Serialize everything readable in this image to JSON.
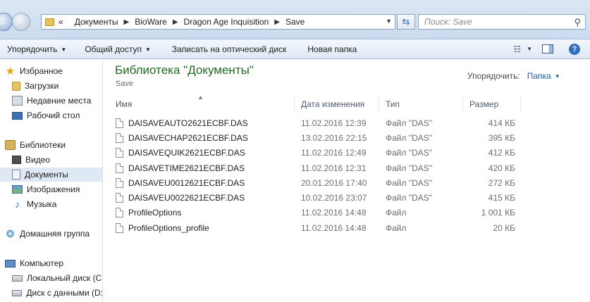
{
  "address": {
    "overflow": "«",
    "crumbs": [
      "Документы",
      "BioWare",
      "Dragon Age Inquisition",
      "Save"
    ]
  },
  "search": {
    "placeholder": "Поиск: Save"
  },
  "toolbar": {
    "organize": "Упорядочить",
    "share": "Общий доступ",
    "burn": "Записать на оптический диск",
    "new_folder": "Новая папка"
  },
  "nav": {
    "favorites": "Избранное",
    "downloads": "Загрузки",
    "recent": "Недавние места",
    "desktop": "Рабочий стол",
    "libraries": "Библиотеки",
    "video": "Видео",
    "documents": "Документы",
    "images": "Изображения",
    "music": "Музыка",
    "homegroup": "Домашняя группа",
    "computer": "Компьютер",
    "local_disk": "Локальный диск (C",
    "data_disk": "Диск с данными (D:"
  },
  "main": {
    "title": "Библиотека \"Документы\"",
    "subtitle": "Save",
    "arrange_label": "Упорядочить:",
    "arrange_value": "Папка"
  },
  "columns": {
    "name": "Имя",
    "date": "Дата изменения",
    "type": "Тип",
    "size": "Размер"
  },
  "files": [
    {
      "name": "DAISAVEAUTO2621ECBF.DAS",
      "date": "11.02.2016 12:39",
      "type": "Файл \"DAS\"",
      "size": "414 КБ"
    },
    {
      "name": "DAISAVECHAP2621ECBF.DAS",
      "date": "13.02.2016 22:15",
      "type": "Файл \"DAS\"",
      "size": "395 КБ"
    },
    {
      "name": "DAISAVEQUIK2621ECBF.DAS",
      "date": "11.02.2016 12:49",
      "type": "Файл \"DAS\"",
      "size": "412 КБ"
    },
    {
      "name": "DAISAVETIME2621ECBF.DAS",
      "date": "11.02.2016 12:31",
      "type": "Файл \"DAS\"",
      "size": "420 КБ"
    },
    {
      "name": "DAISAVEU0012621ECBF.DAS",
      "date": "20.01.2016 17:40",
      "type": "Файл \"DAS\"",
      "size": "272 КБ"
    },
    {
      "name": "DAISAVEU0022621ECBF.DAS",
      "date": "10.02.2016 23:07",
      "type": "Файл \"DAS\"",
      "size": "415 КБ"
    },
    {
      "name": "ProfileOptions",
      "date": "11.02.2016 14:48",
      "type": "Файл",
      "size": "1 001 КБ"
    },
    {
      "name": "ProfileOptions_profile",
      "date": "11.02.2016 14:48",
      "type": "Файл",
      "size": "20 КБ"
    }
  ]
}
